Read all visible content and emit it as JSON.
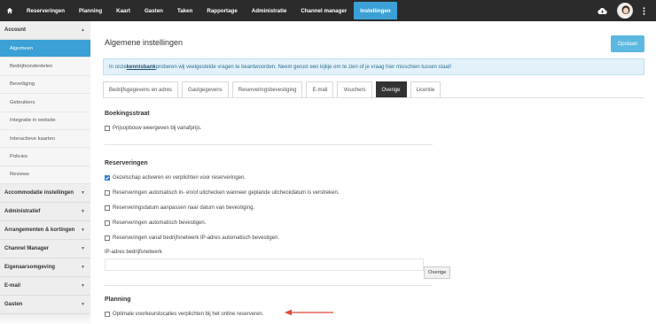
{
  "topnav": {
    "home_icon": "home-icon",
    "items": [
      {
        "label": "Reserveringen"
      },
      {
        "label": "Planning"
      },
      {
        "label": "Kaart"
      },
      {
        "label": "Gasten"
      },
      {
        "label": "Taken"
      },
      {
        "label": "Rapportage"
      },
      {
        "label": "Administratie"
      },
      {
        "label": "Channel manager"
      },
      {
        "label": "Instellingen"
      }
    ],
    "active_item": "Instellingen",
    "right_icons": [
      "cloud-download-icon",
      "user-avatar",
      "more-vertical-icon"
    ]
  },
  "sidebar": {
    "account_label": "Account",
    "account_items": [
      {
        "label": "Algemeen"
      },
      {
        "label": "Bedrijfsonderdelen"
      },
      {
        "label": "Beveiliging"
      },
      {
        "label": "Gebruikers"
      },
      {
        "label": "Integratie in website"
      },
      {
        "label": "Interactieve kaarten"
      },
      {
        "label": "Policies"
      },
      {
        "label": "Reviews"
      }
    ],
    "active_item": "Algemeen",
    "sections": [
      {
        "label": "Accommodatie instellingen"
      },
      {
        "label": "Administratief"
      },
      {
        "label": "Arrangementen & kortingen"
      },
      {
        "label": "Channel Manager"
      },
      {
        "label": "Eigenaarsomgeving"
      },
      {
        "label": "E-mail"
      },
      {
        "label": "Gasten"
      }
    ]
  },
  "main": {
    "title": "Algemene instellingen",
    "save_label": "Opslaan",
    "info": {
      "before": "In onze ",
      "link": "kennisbank",
      "after": " proberen wij veelgestelde vragen te beantwoorden. Neem gerust een kijkje om te zien of je vraag hier misschien tussen staat!"
    },
    "tabs": [
      {
        "label": "Bedrijfsgegevens en adres"
      },
      {
        "label": "Gastgegevens"
      },
      {
        "label": "Reserveringsbevestiging"
      },
      {
        "label": "E-mail"
      },
      {
        "label": "Vouchers"
      },
      {
        "label": "Overige"
      },
      {
        "label": "Licentie"
      }
    ],
    "active_tab": "Overige",
    "boekingsstraat": {
      "title": "Boekingsstraat",
      "options": [
        {
          "label": "Prijsopbouw weergeven bij vanafprijs.",
          "checked": false
        }
      ]
    },
    "reserveringen": {
      "title": "Reserveringen",
      "options": [
        {
          "label": "Gezelschap activeren en verplichten voor reserveringen.",
          "checked": true
        },
        {
          "label": "Reserveringen automatisch in- en/of uitchecken wanneer geplande uitcheckdatum is verstreken.",
          "checked": false
        },
        {
          "label": "Reserveringsdatum aanpassen naar datum van bevestiging.",
          "checked": false
        },
        {
          "label": "Reserveringen automatisch bevestigen.",
          "checked": false
        },
        {
          "label": "Reserveringen vanaf bedrijfsnetwerk IP-adres automatisch bevestigen.",
          "checked": false
        }
      ],
      "ip_label": "IP-adres bedrijfsnetwerk",
      "ip_value": "",
      "override_label": "Overige"
    },
    "planning": {
      "title": "Planning",
      "options": [
        {
          "label": "Optimale voorkeurslocaties verplichten bij het online reserveren.",
          "checked": false
        }
      ]
    },
    "annotation_arrow_color": "#e0483a"
  }
}
